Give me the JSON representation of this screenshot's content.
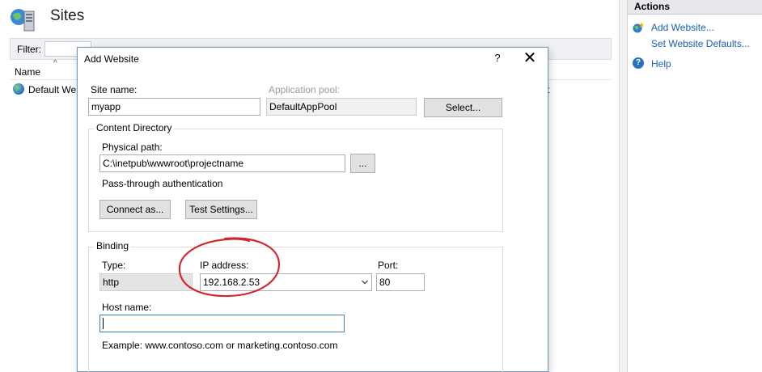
{
  "header": {
    "title": "Sites",
    "icon": "sites-server-icon"
  },
  "filter": {
    "label": "Filter:",
    "value": ""
  },
  "list": {
    "columns": [
      "Name"
    ],
    "rows": [
      {
        "name": "Default We",
        "trailing": "t"
      }
    ]
  },
  "actions": {
    "title": "Actions",
    "items": [
      {
        "label": "Add Website...",
        "icon": "add-website-icon"
      },
      {
        "label": "Set Website Defaults...",
        "icon": ""
      },
      {
        "label": "Help",
        "icon": "help-icon"
      }
    ]
  },
  "dialog": {
    "title": "Add Website",
    "help_glyph": "?",
    "close_glyph": "✕",
    "site_name": {
      "label": "Site name:",
      "value": "myapp"
    },
    "app_pool": {
      "label": "Application pool:",
      "value": "DefaultAppPool",
      "button": "Select..."
    },
    "content_directory": {
      "legend": "Content Directory",
      "physical_path_label": "Physical path:",
      "physical_path_value": "C:\\inetpub\\wwwroot\\projectname",
      "browse_label": "...",
      "auth_label": "Pass-through authentication",
      "connect_as": "Connect as...",
      "test_settings": "Test Settings..."
    },
    "binding": {
      "legend": "Binding",
      "type_label": "Type:",
      "type_value": "http",
      "ip_label": "IP address:",
      "ip_value": "192.168.2.53",
      "port_label": "Port:",
      "port_value": "80",
      "host_label": "Host name:",
      "host_value": "",
      "example": "Example: www.contoso.com or marketing.contoso.com"
    }
  },
  "annotation": {
    "color": "#d0282e",
    "shape": "hand-drawn-ellipse"
  },
  "colors": {
    "link": "#1a5fb4",
    "dialog_border": "#6e9bc8"
  }
}
